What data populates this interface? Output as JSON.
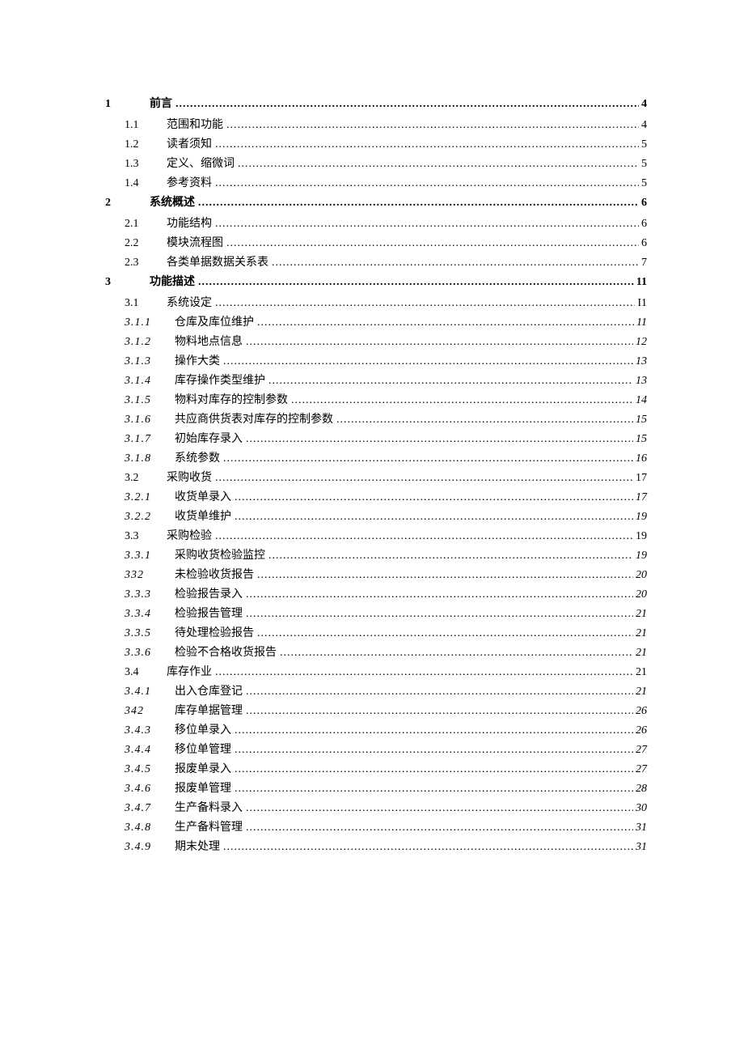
{
  "entries": [
    {
      "level": 1,
      "num": "1",
      "title": "前言",
      "page": "4"
    },
    {
      "level": 2,
      "num": "1.1",
      "title": "范围和功能",
      "page": "4"
    },
    {
      "level": 2,
      "num": "1.2",
      "title": "读者须知",
      "page": "5"
    },
    {
      "level": 2,
      "num": "1.3",
      "title": "定义、缩微词",
      "page": "5"
    },
    {
      "level": 2,
      "num": "1.4",
      "title": "参考资料",
      "page": "5"
    },
    {
      "level": 1,
      "num": "2",
      "title": "系统概述",
      "page": "6"
    },
    {
      "level": 2,
      "num": "2.1",
      "title": "功能结构",
      "page": "6"
    },
    {
      "level": 2,
      "num": "2.2",
      "title": "模块流程图",
      "page": "6"
    },
    {
      "level": 2,
      "num": "2.3",
      "title": "各类单据数据关系表",
      "page": "7"
    },
    {
      "level": 1,
      "num": "3",
      "title": "功能描述",
      "page": "11"
    },
    {
      "level": 2,
      "num": "3.1",
      "title": "系统设定",
      "page": "I1"
    },
    {
      "level": 3,
      "num": "3.1.1",
      "title": "仓库及库位维护",
      "page": "11"
    },
    {
      "level": 3,
      "num": "3.1.2",
      "title": "物料地点信息",
      "page": "12"
    },
    {
      "level": 3,
      "num": "3.1.3",
      "title": "操作大类",
      "page": "13"
    },
    {
      "level": 3,
      "num": "3.1.4",
      "title": "库存操作类型维护",
      "page": "13"
    },
    {
      "level": 3,
      "num": "3.1.5",
      "title": "物料对库存的控制参数",
      "page": "14"
    },
    {
      "level": 3,
      "num": "3.1.6",
      "title": "共应商供货表对库存的控制参数",
      "page": "15"
    },
    {
      "level": 3,
      "num": "3.1.7",
      "title": "初始库存录入",
      "page": "15"
    },
    {
      "level": 3,
      "num": "3.1.8",
      "title": "系统参数",
      "page": "16"
    },
    {
      "level": 2,
      "num": "3.2",
      "title": "采购收货",
      "page": "17"
    },
    {
      "level": 3,
      "num": "3.2.1",
      "title": "收货单录入",
      "page": "17"
    },
    {
      "level": 3,
      "num": "3.2.2",
      "title": "收货单维护",
      "page": "19"
    },
    {
      "level": 2,
      "num": "3.3",
      "title": "采购检验",
      "page": "19"
    },
    {
      "level": 3,
      "num": "3.3.1",
      "title": "采购收货检验监控",
      "page": "19"
    },
    {
      "level": 3,
      "num": "332",
      "title": "未检验收货报告",
      "page": "20"
    },
    {
      "level": 3,
      "num": "3.3.3",
      "title": "检验报告录入",
      "page": "20"
    },
    {
      "level": 3,
      "num": "3.3.4",
      "title": "检验报告管理",
      "page": "21"
    },
    {
      "level": 3,
      "num": "3.3.5",
      "title": "待处理检验报告",
      "page": "21"
    },
    {
      "level": 3,
      "num": "3.3.6",
      "title": "检验不合格收货报告",
      "page": "21"
    },
    {
      "level": 2,
      "num": "3.4",
      "title": "库存作业",
      "page": "21"
    },
    {
      "level": 3,
      "num": "3.4.1",
      "title": "出入仓库登记",
      "page": "21"
    },
    {
      "level": 3,
      "num": "342",
      "title": "库存单据管理",
      "page": "26"
    },
    {
      "level": 3,
      "num": "3.4.3",
      "title": "移位单录入",
      "page": "26"
    },
    {
      "level": 3,
      "num": "3.4.4",
      "title": "移位单管理",
      "page": "27"
    },
    {
      "level": 3,
      "num": "3.4.5",
      "title": "报废单录入",
      "page": "27"
    },
    {
      "level": 3,
      "num": "3.4.6",
      "title": "报废单管理",
      "page": "28"
    },
    {
      "level": 3,
      "num": "3.4.7",
      "title": "生产备料录入",
      "page": "30"
    },
    {
      "level": 3,
      "num": "3.4.8",
      "title": "生产备料管理",
      "page": "31"
    },
    {
      "level": 3,
      "num": "3.4.9",
      "title": "期末处理",
      "page": "31"
    }
  ]
}
